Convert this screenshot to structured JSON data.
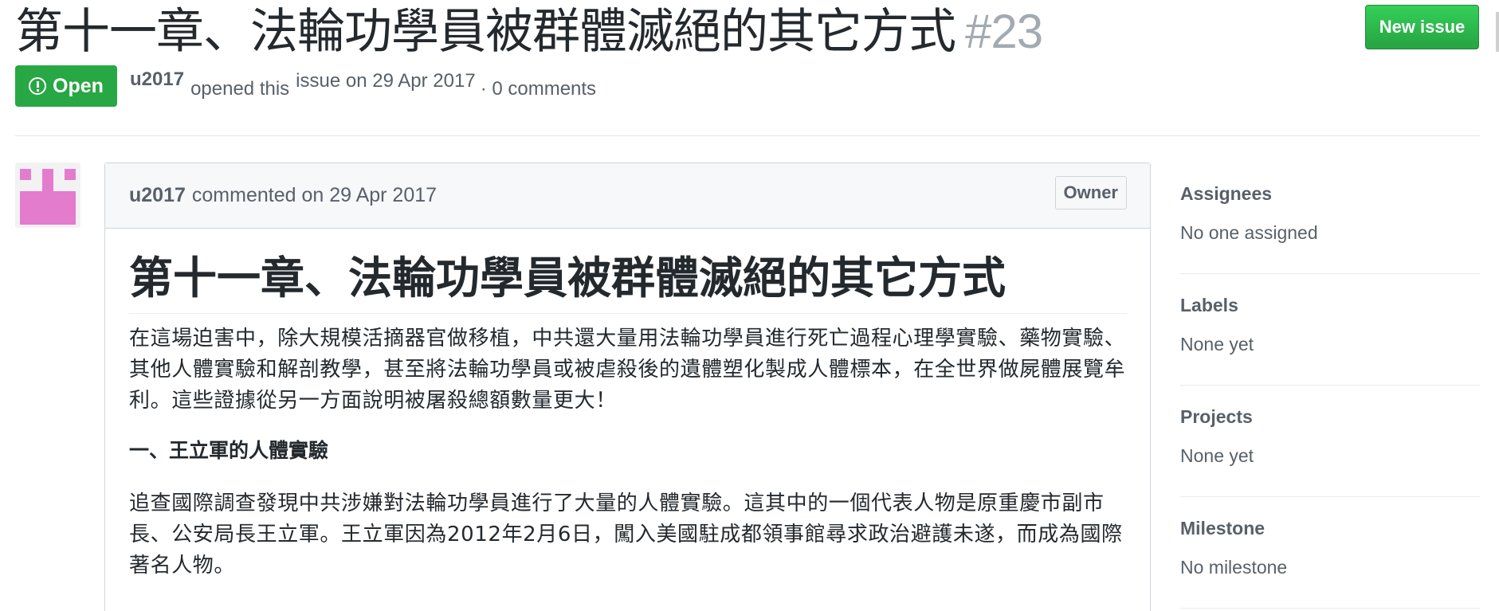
{
  "header": {
    "title": "第十一章、法輪功學員被群體滅絕的其它方式",
    "number": "#23",
    "new_issue_label": "New issue"
  },
  "meta": {
    "state": "Open",
    "author": "u2017",
    "opened_text": "opened this",
    "issue_on": "issue on 29 Apr 2017",
    "comments": "· 0 comments"
  },
  "comment": {
    "author": "u2017",
    "action": "commented on 29 Apr 2017",
    "badge": "Owner",
    "heading": "第十一章、法輪功學員被群體滅絕的其它方式",
    "para1": "在這場迫害中，除大規模活摘器官做移植，中共還大量用法輪功學員進行死亡過程心理學實驗、藥物實驗、其他人體實驗和解剖教學，甚至將法輪功學員或被虐殺後的遺體塑化製成人體標本，在全世界做屍體展覽牟利。這些證據從另一方面說明被屠殺總額數量更大！",
    "subhead": "一、王立軍的人體實驗",
    "para2": "追查國際調查發現中共涉嫌對法輪功學員進行了大量的人體實驗。這其中的一個代表人物是原重慶市副市長、公安局長王立軍。王立軍因為2012年2月6日，闖入美國駐成都領事館尋求政治避護未遂，而成為國際著名人物。"
  },
  "sidebar": {
    "sections": [
      {
        "label": "Assignees",
        "value": "No one assigned"
      },
      {
        "label": "Labels",
        "value": "None yet"
      },
      {
        "label": "Projects",
        "value": "None yet"
      },
      {
        "label": "Milestone",
        "value": "No milestone"
      }
    ]
  },
  "colors": {
    "open_green": "#28a745",
    "avatar_pink": "#e37ccd"
  }
}
